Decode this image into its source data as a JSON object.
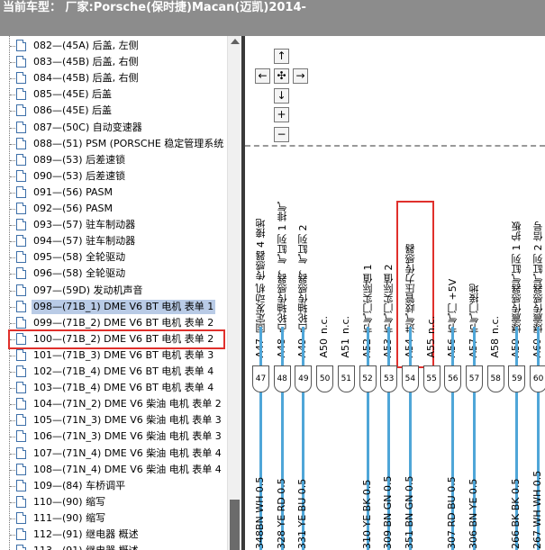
{
  "header": {
    "title": "当前车型： 厂家:Porsche(保时捷)Macan(迈凯)2014-"
  },
  "tree": {
    "items": [
      {
        "label": "082—(45A) 后盖, 左侧"
      },
      {
        "label": "083—(45B) 后盖, 右侧"
      },
      {
        "label": "084—(45B) 后盖, 右侧"
      },
      {
        "label": "085—(45E) 后盖"
      },
      {
        "label": "086—(45E) 后盖"
      },
      {
        "label": "087—(50C) 自动变速器"
      },
      {
        "label": "088—(51) PSM (PORSCHE 稳定管理系统"
      },
      {
        "label": "089—(53) 后差速锁"
      },
      {
        "label": "090—(53) 后差速锁"
      },
      {
        "label": "091—(56) PASM"
      },
      {
        "label": "092—(56) PASM"
      },
      {
        "label": "093—(57) 驻车制动器"
      },
      {
        "label": "094—(57) 驻车制动器"
      },
      {
        "label": "095—(58) 全轮驱动"
      },
      {
        "label": "096—(58) 全轮驱动"
      },
      {
        "label": "097—(59D) 发动机声音"
      },
      {
        "label": "098—(71B_1) DME V6 BT 电机 表单 1"
      },
      {
        "label": "099—(71B_2) DME V6 BT 电机 表单 2"
      },
      {
        "label": "100—(71B_2) DME V6 BT 电机 表单 2"
      },
      {
        "label": "101—(71B_3) DME V6 BT 电机 表单 3"
      },
      {
        "label": "102—(71B_4) DME V6 BT 电机 表单 4"
      },
      {
        "label": "103—(71B_4) DME V6 BT 电机 表单 4"
      },
      {
        "label": "104—(71N_2) DME V6 柴油 电机 表单 2"
      },
      {
        "label": "105—(71N_3) DME V6 柴油 电机 表单 3"
      },
      {
        "label": "106—(71N_3) DME V6 柴油 电机 表单 3"
      },
      {
        "label": "107—(71N_4) DME V6 柴油 电机 表单 4"
      },
      {
        "label": "108—(71N_4) DME V6 柴油 电机 表单 4"
      },
      {
        "label": "109—(84) 车桥调平"
      },
      {
        "label": "110—(90) 缩写"
      },
      {
        "label": "111—(90) 缩写"
      },
      {
        "label": "112—(91) 继电器 概述"
      },
      {
        "label": "113—(91) 继电器 概述"
      }
    ]
  },
  "diagram": {
    "nav": {
      "up": "↑",
      "left": "←",
      "center": "✣",
      "right": "→",
      "down": "↓",
      "zoom_in": "+",
      "zoom_out": "−"
    },
    "pins": [
      {
        "desc": "固定发动机 传感器 4 接地",
        "id": "A47",
        "num": "47",
        "wire": "348BN WH 0.5"
      },
      {
        "desc": "凸轮轴传感器，气缸列 1 排气",
        "id": "A48",
        "num": "48",
        "wire": "328 YE RD 0.5"
      },
      {
        "desc": "凸轮轴传感器，气缸列 2",
        "id": "A49",
        "num": "49",
        "wire": "331 YE BU 0.5"
      },
      {
        "desc": "n.c.",
        "id": "A50",
        "num": "50",
        "wire": ""
      },
      {
        "desc": "n.c.",
        "id": "A51",
        "num": "51",
        "wire": ""
      },
      {
        "desc": "节气门实际值 1",
        "id": "A52",
        "num": "52",
        "wire": "310 YE BK 0.5"
      },
      {
        "desc": "节气门实际值 2",
        "id": "A53",
        "num": "53",
        "wire": "309 BN GN 0.5"
      },
      {
        "desc": "进气歧管压力传感器",
        "id": "A54",
        "num": "54",
        "wire": "351 BN GN 0.5"
      },
      {
        "desc": "n.c.",
        "id": "A55",
        "num": "55",
        "wire": ""
      },
      {
        "desc": "节气门 +5V",
        "id": "A56",
        "num": "56",
        "wire": "307 RD BU 0.5"
      },
      {
        "desc": "节气门接地",
        "id": "A57",
        "num": "57",
        "wire": "306 BN YE 0.5"
      },
      {
        "desc": "n.c.",
        "id": "A58",
        "num": "58",
        "wire": ""
      },
      {
        "desc": "爆震传感器气缸列 1 护板",
        "id": "A59",
        "num": "59",
        "wire": "266 BK BK 0.5"
      },
      {
        "desc": "爆震传感器气缸列 2 信号",
        "id": "A60",
        "num": "60",
        "wire": "267 WH WH 0.5"
      }
    ]
  },
  "colors": {
    "highlight": "#e0302c",
    "wire": "#4fa6d8",
    "selection": "#b9cbe6",
    "titlebar": "#8c8c8c"
  }
}
